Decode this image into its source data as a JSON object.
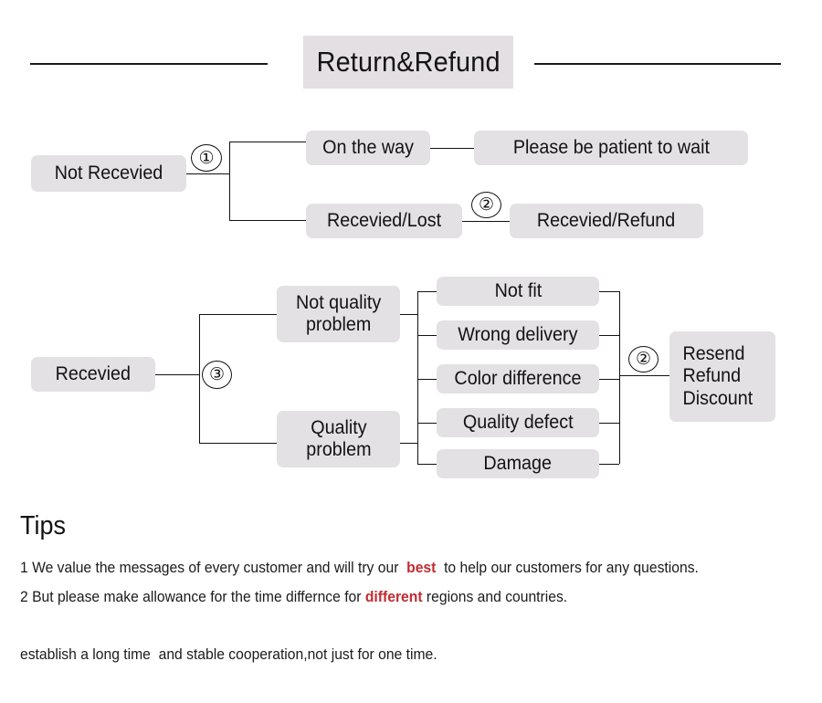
{
  "header": {
    "title": "Return&Refund"
  },
  "flow_not_received": {
    "root": "Not Recevied",
    "marker_root": "①",
    "branch_top": "On the way",
    "branch_top_result": "Please be patient to wait",
    "branch_bottom": "Recevied/Lost",
    "marker_bottom": "②",
    "branch_bottom_result": "Recevied/Refund"
  },
  "flow_received": {
    "root": "Recevied",
    "marker_root": "③",
    "category_top": "Not quality\nproblem",
    "category_bottom": "Quality\nproblem",
    "reasons": [
      "Not fit",
      "Wrong delivery",
      "Color difference",
      "Quality defect",
      "Damage"
    ],
    "marker_outcome": "②",
    "outcome": "Resend\nRefund\nDiscount"
  },
  "tips": {
    "heading": "Tips",
    "line1_before": "1 We value the messages of every customer and will try our  ",
    "line1_accent": "best",
    "line1_after": "  to help our customers for any questions.",
    "line2_before": "2 But please make allowance for the time differnce for ",
    "line2_accent": "different",
    "line2_after": " regions and countries.",
    "line3": "establish a long time  and stable cooperation,not just for one time."
  },
  "colors": {
    "box_fill": "#e4e1e4",
    "title_fill": "#e3dfe2",
    "line": "#111111",
    "accent_red": "#c32b32",
    "text": "#131313"
  }
}
